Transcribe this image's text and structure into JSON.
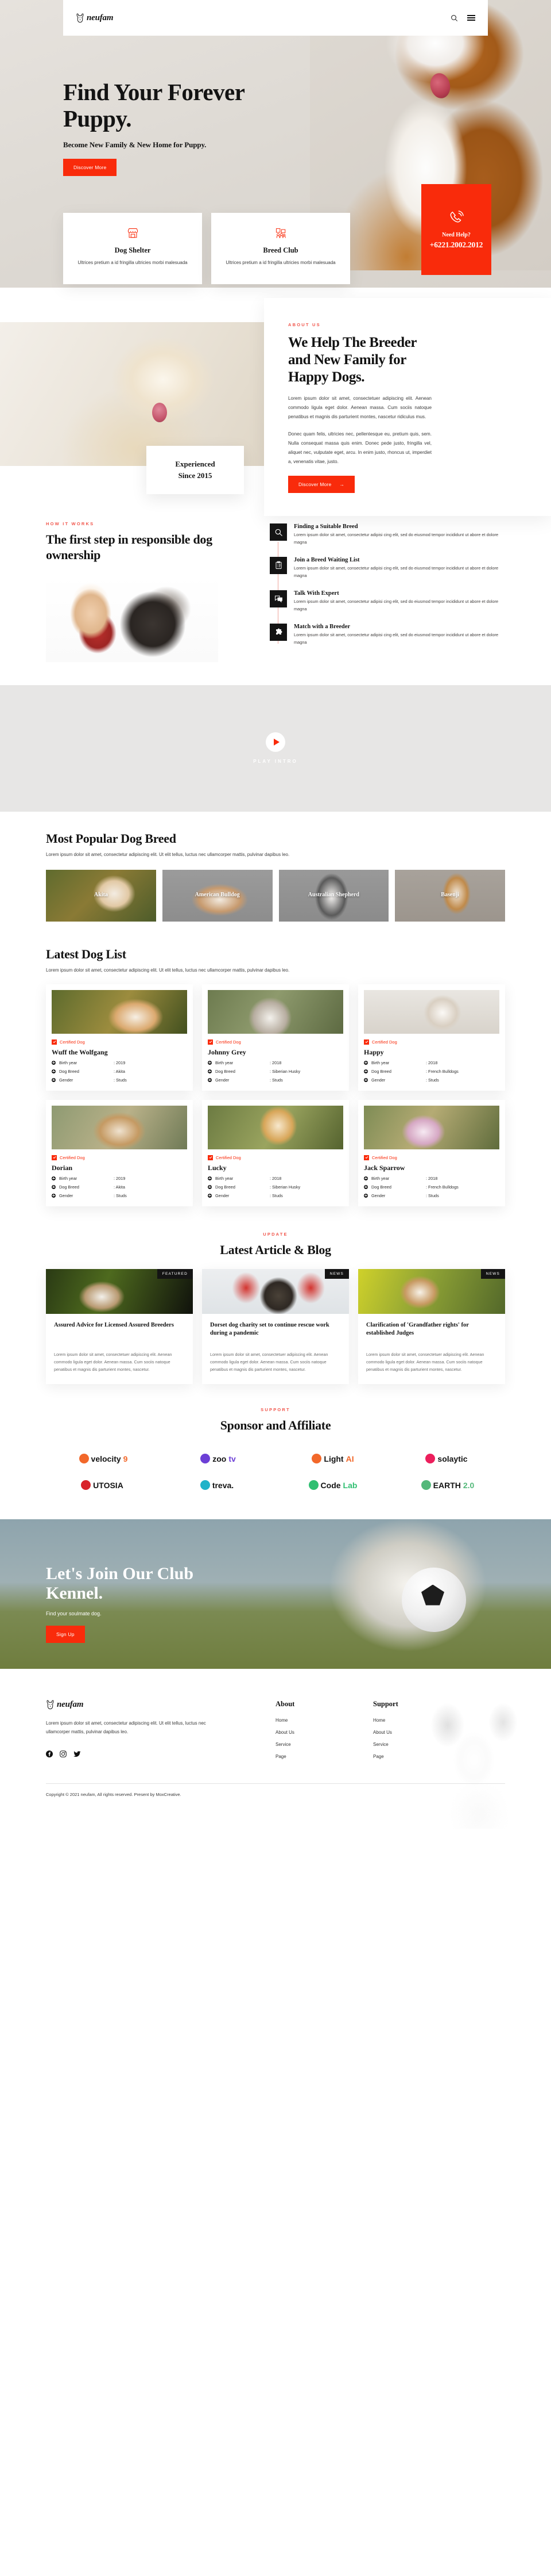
{
  "brand": {
    "name": "neufam",
    "logo_icon": "dog-head-icon"
  },
  "nav": {
    "search_icon": "search-icon",
    "menu_icon": "hamburger-menu-icon"
  },
  "hero": {
    "title": "Find Your Forever Puppy.",
    "subtitle": "Become New Family & New Home for Puppy.",
    "cta": "Discover More"
  },
  "call_card": {
    "phone_icon": "phone-ring-icon",
    "need_help": "Need Help?",
    "phone": "+6221.2002.2012"
  },
  "features": [
    {
      "icon": "shop-store-icon",
      "title": "Dog Shelter",
      "text": "Ultrices pretium a id fringilla ultricies morbi malesuada"
    },
    {
      "icon": "dog-group-icon",
      "title": "Breed Club",
      "text": "Ultrices pretium a id fringilla ultricies morbi malesuada"
    }
  ],
  "about": {
    "eyebrow": "ABOUT US",
    "title": "We Help The Breeder and New Family for Happy Dogs.",
    "p1": "Lorem ipsum dolor sit amet, consectetuer adipiscing elit. Aenean commodo ligula eget dolor. Aenean massa. Cum sociis natoque penatibus et magnis dis parturient montes, nascetur ridiculus mus.",
    "p2": "Donec quam felis, ultricies nec, pellentesque eu, pretium quis, sem. Nulla consequat massa quis enim. Donec pede justo, fringilla vel, aliquet nec, vulputate eget, arcu. In enim justo, rhoncus ut, imperdiet a, venenatis vitae, justo.",
    "cta": "Discover More",
    "badge_line1": "Experienced",
    "badge_line2": "Since 2015"
  },
  "how": {
    "eyebrow": "HOW IT WORKS",
    "title": "The first step in responsible dog ownership",
    "steps": [
      {
        "icon": "search-icon",
        "title": "Finding a Suitable Breed",
        "text": "Lorem ipsum dolor sit amet, consectetur adipisi cing elit, sed do eiusmod tempor incididunt ut abore et dolore magna"
      },
      {
        "icon": "clipboard-list-icon",
        "title": "Join a Breed Waiting List",
        "text": "Lorem ipsum dolor sit amet, consectetur adipisi cing elit, sed do eiusmod tempor incididunt ut abore et dolore magna"
      },
      {
        "icon": "chat-bubbles-icon",
        "title": "Talk With Expert",
        "text": "Lorem ipsum dolor sit amet, consectetur adipisi cing elit, sed do eiusmod tempor incididunt ut abore et dolore magna"
      },
      {
        "icon": "puzzle-piece-icon",
        "title": "Match with a Breeder",
        "text": "Lorem ipsum dolor sit amet, consectetur adipisi cing elit, sed do eiusmod tempor incididunt ut abore et dolore magna"
      }
    ]
  },
  "video": {
    "play_icon": "play-triangle-icon",
    "label": "PLAY INTRO"
  },
  "breeds": {
    "title": "Most Popular Dog Breed",
    "desc": "Lorem ipsum dolor sit amet, consectetur adipiscing elit. Ut elit tellus, luctus nec ullamcorper mattis, pulvinar dapibus leo.",
    "items": [
      {
        "name": "Akita"
      },
      {
        "name": "American Bulldog"
      },
      {
        "name": "Australian Shepherd"
      },
      {
        "name": "Basenji"
      }
    ]
  },
  "dog_list": {
    "title": "Latest Dog List",
    "desc": "Lorem ipsum dolor sit amet, consectetur adipiscing elit. Ut elit tellus, luctus nec ullamcorper mattis, pulvinar dapibus leo.",
    "badge": "Certified Dog",
    "spec_labels": {
      "birth": "Birth year",
      "breed": "Dog Breed",
      "gender": "Gender"
    },
    "items": [
      {
        "name": "Wuff the Wolfgang",
        "birth": ": 2019",
        "breed": ": Akita",
        "gender": ": Studs"
      },
      {
        "name": "Johnny Grey",
        "birth": ": 2018",
        "breed": ": Siberian Husky",
        "gender": ": Studs"
      },
      {
        "name": "Happy",
        "birth": ": 2018",
        "breed": ": French Bulldogs",
        "gender": ": Studs"
      },
      {
        "name": "Dorian",
        "birth": ": 2019",
        "breed": ": Akita",
        "gender": ": Studs"
      },
      {
        "name": "Lucky",
        "birth": ": 2018",
        "breed": ": Siberian Husky",
        "gender": ": Studs"
      },
      {
        "name": "Jack Sparrow",
        "birth": ": 2018",
        "breed": ": French Bulldogs",
        "gender": ": Studs"
      }
    ]
  },
  "blog": {
    "eyebrow": "UPDATE",
    "title": "Latest Article & Blog",
    "items": [
      {
        "tag": "FEATURED",
        "title": "Assured Advice for Licensed Assured Breeders",
        "excerpt": "Lorem ipsum dolor sit amet, consectetuer adipiscing elit. Aenean commodo ligula eget dolor. Aenean massa. Cum sociis natoque penatibus et magnis dis parturient montes, nascetur."
      },
      {
        "tag": "NEWS",
        "title": "Dorset dog charity set to continue rescue work during a pandemic",
        "excerpt": "Lorem ipsum dolor sit amet, consectetuer adipiscing elit. Aenean commodo ligula eget dolor. Aenean massa. Cum sociis natoque penatibus et magnis dis parturient montes, nascetur."
      },
      {
        "tag": "NEWS",
        "title": "Clarification of 'Grandfather rights' for established Judges",
        "excerpt": "Lorem ipsum dolor sit amet, consectetuer adipiscing elit. Aenean commodo ligula eget dolor. Aenean massa. Cum sociis natoque penatibus et magnis dis parturient montes, nascetur."
      }
    ]
  },
  "sponsors": {
    "eyebrow": "SUPPORT",
    "title": "Sponsor and Affiliate",
    "items": [
      {
        "name": "velocity9",
        "text1": "velocity",
        "text2": "9",
        "color": "#f2682a"
      },
      {
        "name": "zootv",
        "text1": "zoo",
        "text2": "tv",
        "color": "#6c3fd6"
      },
      {
        "name": "LightAI",
        "text1": "Light",
        "text2": "AI",
        "color": "#f2682a"
      },
      {
        "name": "solaytic",
        "text1": "solaytic",
        "text2": "",
        "color": "#ec1f5c"
      },
      {
        "name": "UTOSIA",
        "text1": "UTOSIA",
        "text2": "",
        "color": "#d8232a"
      },
      {
        "name": "treva.",
        "text1": "treva.",
        "text2": "",
        "color": "#20b3c9"
      },
      {
        "name": "CodeLab",
        "text1": "Code",
        "text2": "Lab",
        "color": "#2fbf71"
      },
      {
        "name": "EARTH2.0",
        "text1": "EARTH",
        "text2": "2.0",
        "color": "#54b87a"
      }
    ]
  },
  "cta": {
    "title": "Let's Join Our Club Kennel.",
    "desc": "Find your soulmate dog.",
    "button": "Sign Up"
  },
  "footer": {
    "desc": "Lorem ipsum dolor sit amet, consectetur adipiscing elit. Ut elit tellus, luctus nec ullamcorper mattis, pulvinar dapibus leo.",
    "social": [
      {
        "icon": "facebook-icon"
      },
      {
        "icon": "instagram-icon"
      },
      {
        "icon": "twitter-icon"
      }
    ],
    "columns": [
      {
        "heading": "About",
        "links": [
          "Home",
          "About Us",
          "Service",
          "Page"
        ]
      },
      {
        "heading": "Support",
        "links": [
          "Home",
          "About Us",
          "Service",
          "Page"
        ]
      }
    ],
    "copyright": "Copyright © 2021 neufam, All rights reserved. Present by MoxCreative."
  },
  "colors": {
    "accent": "#f92b0b",
    "eyebrow": "#f1544a",
    "dark": "#141414"
  }
}
